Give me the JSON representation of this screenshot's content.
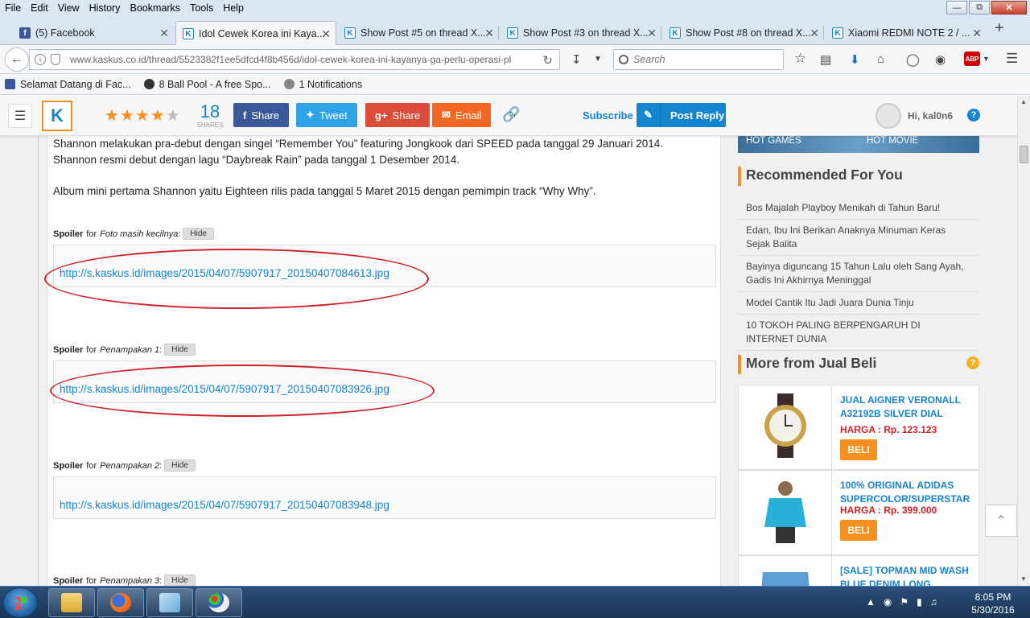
{
  "menu": [
    "File",
    "Edit",
    "View",
    "History",
    "Bookmarks",
    "Tools",
    "Help"
  ],
  "tabs": [
    {
      "label": "(5) Facebook",
      "icon": "facebook-icon"
    },
    {
      "label": "Idol Cewek Korea ini Kaya...",
      "icon": "kaskus-icon"
    },
    {
      "label": "Show Post #5 on thread X...",
      "icon": "kaskus-icon"
    },
    {
      "label": "Show Post #3 on thread X...",
      "icon": "kaskus-icon"
    },
    {
      "label": "Show Post #8 on thread X...",
      "icon": "kaskus-icon"
    },
    {
      "label": "Xiaomi REDMI NOTE 2 / ...",
      "icon": "kaskus-icon"
    }
  ],
  "nav": {
    "url": "www.kaskus.co.id/thread/5523382f1ee5dfcd4f8b456d/idol-cewek-korea-ini-kayanya-ga-perlu-operasi-pl",
    "search_placeholder": "Search",
    "abp": "ABP"
  },
  "bookmarks": [
    "Selamat Datang di Fac...",
    "8 Ball Pool - A free Spo...",
    "1  Notifications"
  ],
  "kaskus_bar": {
    "rating": 4,
    "shares_count": "18",
    "shares_label": "SHARES",
    "share_fb": "Share",
    "tweet": "Tweet",
    "share_gplus": "Share",
    "email": "Email",
    "subscribe": "Subscribe",
    "post_reply": "Post Reply",
    "greeting": "Hi, kal0n6",
    "help": "?"
  },
  "post": {
    "para1_line1": "Shannon melakukan pra-debut dengan singel “Remember You” featuring Jongkook dari SPEED pada tanggal 29 Januari 2014.",
    "para1_line2": "Shannon resmi debut dengan lagu “Daybreak Rain” pada tanggal 1 Desember 2014.",
    "para2": "Album mini pertama Shannon yaitu Eighteen rilis pada tanggal 5 Maret 2015 dengan pemimpin track “Why Why”.",
    "spoilers": [
      {
        "label": "Spoiler",
        "for": "for",
        "title": "Foto masih kecilnya",
        "hide": "Hide",
        "link": "http://s.kaskus.id/images/2015/04/07/5907917_20150407084613.jpg"
      },
      {
        "label": "Spoiler",
        "for": "for",
        "title": "Penampakan 1",
        "hide": "Hide",
        "link": "http://s.kaskus.id/images/2015/04/07/5907917_20150407083926.jpg"
      },
      {
        "label": "Spoiler",
        "for": "for",
        "title": "Penampakan 2",
        "hide": "Hide",
        "link": "http://s.kaskus.id/images/2015/04/07/5907917_20150407083948.jpg"
      },
      {
        "label": "Spoiler",
        "for": "for",
        "title": "Penampakan 3",
        "hide": "Hide"
      }
    ]
  },
  "sidebar": {
    "hot_games": "HOT GAMES",
    "hot_movie": "HOT MOVIE",
    "recommended_title": "Recommended For You",
    "recommended": [
      "Bos Majalah Playboy Menikah di Tahun Baru!",
      "Edan, Ibu Ini Berikan Anaknya Minuman Keras Sejak Balita",
      "Bayinya diguncang 15 Tahun Lalu oleh Sang Ayah, Gadis Ini Akhirnya Meninggal",
      "Model Cantik Itu Jadi Juara Dunia Tinju",
      "10 TOKOH PALING BERPENGARUH DI INTERNET DUNIA"
    ],
    "jualbeli_title": "More from Jual Beli",
    "jualbeli_help": "?",
    "products": [
      {
        "title": "JUAL AIGNER VERONALL A32192B SILVER DIAL",
        "price": "HARGA : Rp. 123.123",
        "buy": "BELI"
      },
      {
        "title": "100% ORIGINAL ADIDAS SUPERCOLOR/SUPERSTAR",
        "price": "HARGA : Rp. 399.000",
        "buy": "BELI"
      },
      {
        "title": "[SALE] TOPMAN MID WASH BLUE DENIM LONG"
      }
    ]
  },
  "taskbar": {
    "time": "8:05 PM",
    "date": "5/30/2016"
  },
  "colors": {
    "kaskus_blue": "#1484ce",
    "kaskus_orange": "#f78f1e",
    "facebook": "#3b5998",
    "twitter": "#2fa3e6",
    "gplus": "#dd4b39",
    "email": "#f26722",
    "annotation_red": "#d0202a"
  }
}
